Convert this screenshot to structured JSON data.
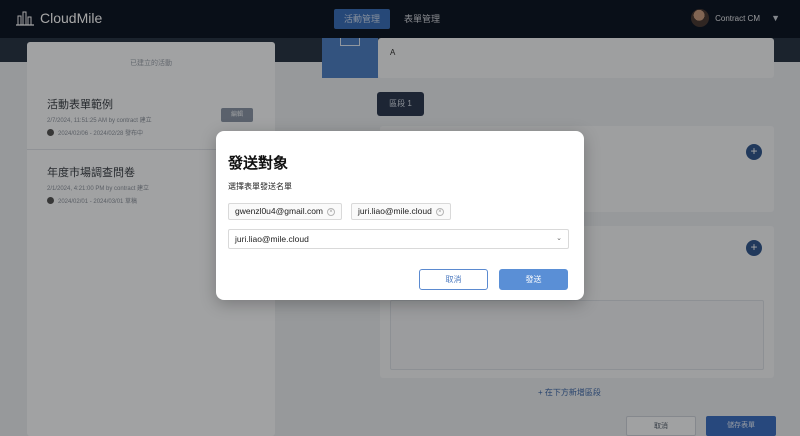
{
  "brand": {
    "name": "CloudMile"
  },
  "nav": {
    "tabs": [
      "活動管理",
      "表單管理"
    ]
  },
  "user": {
    "name": "Contract CM"
  },
  "left_panel": {
    "title": "已建立的活動",
    "items": [
      {
        "title": "活動表單範例",
        "meta": "2/7/2024, 11:51:25 AM by contract 建立",
        "stats": "2024/02/06 - 2024/02/28 發布中"
      },
      {
        "title": "年度市場調查問卷",
        "meta": "2/1/2024, 4:21:00 PM by contract 建立",
        "stats": "2024/02/01 - 2024/03/01 草稿"
      }
    ],
    "status_button": "編輯"
  },
  "main": {
    "label_a": "A",
    "dark_button": "區段 1",
    "add_section_link": "+ 在下方新增區段",
    "bottom_cancel": "取消",
    "bottom_submit": "儲存表單"
  },
  "modal": {
    "title": "發送對象",
    "subtitle": "選擇表單發送名單",
    "chips": [
      "gwenzl0u4@gmail.com",
      "juri.liao@mile.cloud"
    ],
    "select_value": "juri.liao@mile.cloud",
    "cancel": "取消",
    "send": "發送"
  },
  "colors": {
    "accent": "#5a8fd6",
    "navbar": "#0f1726"
  }
}
